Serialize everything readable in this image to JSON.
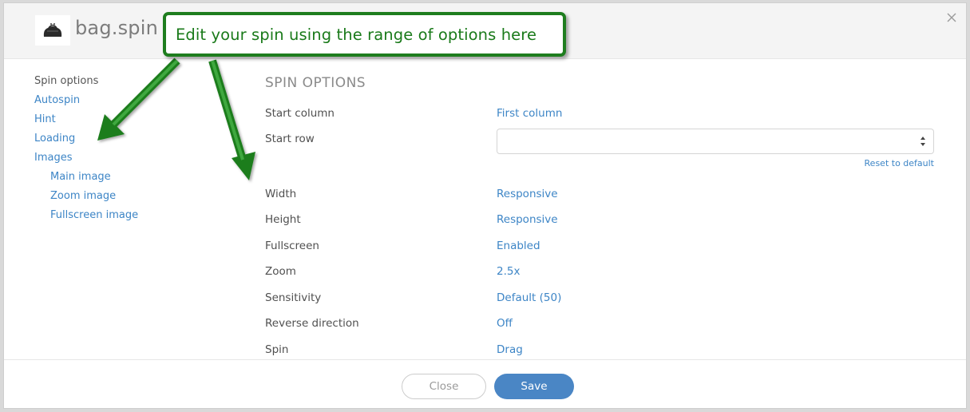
{
  "header": {
    "title": "bag.spin",
    "logo_icon": "bag-icon",
    "close_icon": "close-icon"
  },
  "callout": {
    "text": "Edit your spin using the range of options here",
    "color": "#1e7d1e"
  },
  "sidebar": {
    "items": [
      {
        "label": "Spin options",
        "active": true
      },
      {
        "label": "Autospin"
      },
      {
        "label": "Hint"
      },
      {
        "label": "Loading"
      },
      {
        "label": "Images"
      },
      {
        "label": "Main image",
        "sub": true
      },
      {
        "label": "Zoom image",
        "sub": true
      },
      {
        "label": "Fullscreen image",
        "sub": true
      }
    ]
  },
  "main": {
    "section_title": "SPIN OPTIONS",
    "start_column": {
      "label": "Start column",
      "value": "First column"
    },
    "start_row": {
      "label": "Start row",
      "value": ""
    },
    "reset_label": "Reset to default",
    "options": [
      {
        "label": "Width",
        "value": "Responsive"
      },
      {
        "label": "Height",
        "value": "Responsive"
      },
      {
        "label": "Fullscreen",
        "value": "Enabled"
      },
      {
        "label": "Zoom",
        "value": "2.5x"
      },
      {
        "label": "Sensitivity",
        "value": "Default (50)"
      },
      {
        "label": "Reverse direction",
        "value": "Off"
      },
      {
        "label": "Spin",
        "value": "Drag"
      }
    ]
  },
  "footer": {
    "close_label": "Close",
    "save_label": "Save"
  },
  "colors": {
    "accent": "#3d85c6",
    "save_button": "#4a86c5",
    "callout_green": "#1e7d1e"
  }
}
